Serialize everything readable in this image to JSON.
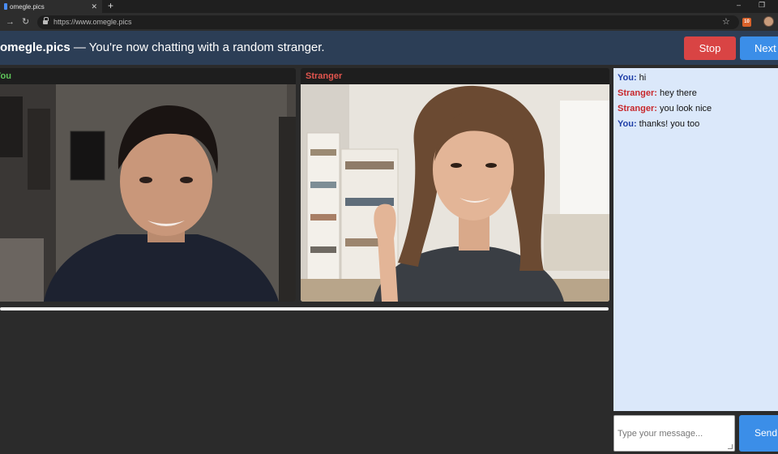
{
  "browser": {
    "tab_title": "omegle.pics",
    "tab_close": "✕",
    "new_tab": "+",
    "url": "https://www.omegle.pics",
    "minimize": "–",
    "restore": "❐",
    "ext_badge": "10"
  },
  "header": {
    "site": "omegle.pics",
    "status": " — You're now chatting with a random stranger.",
    "stop_label": "Stop",
    "next_label": "Next"
  },
  "video": {
    "you_label": "You",
    "stranger_label": "Stranger",
    "you_color": "#5fc65a",
    "stranger_color": "#e2554e"
  },
  "chat": {
    "messages": [
      {
        "sender": "You:",
        "text": " hi"
      },
      {
        "sender": "Stranger:",
        "text": " hey there"
      },
      {
        "sender": "Stranger:",
        "text": " you look nice"
      },
      {
        "sender": "You:",
        "text": " thanks! you too"
      }
    ],
    "input_placeholder": "Type your message...",
    "send_label": "Send"
  },
  "colors": {
    "header_bg": "#2c3e56",
    "stop": "#d94444",
    "next": "#3b8ee8",
    "chat_bg": "#dbe8fa"
  }
}
